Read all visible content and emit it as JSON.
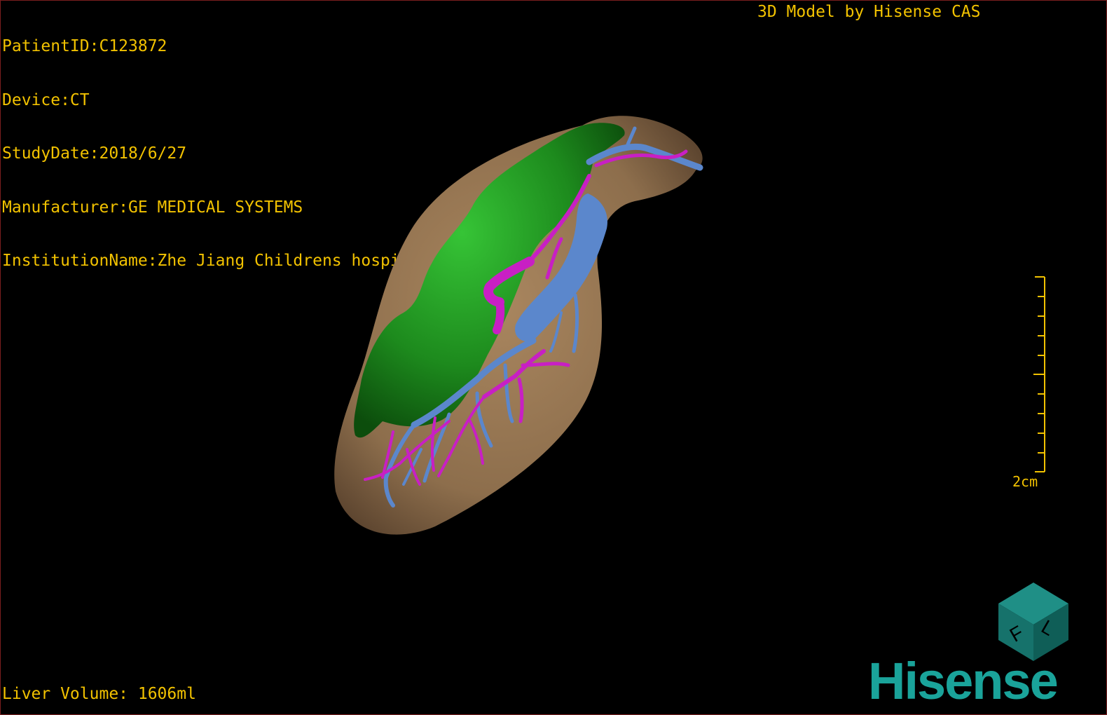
{
  "header": {
    "patient_id": "PatientID:C123872",
    "device": "Device:CT",
    "study_date": "StudyDate:2018/6/27",
    "manufacturer": "Manufacturer:GE MEDICAL SYSTEMS",
    "institution": "InstitutionName:Zhe Jiang Childrens hospital"
  },
  "model_label": "3D Model by Hisense CAS",
  "footer": {
    "liver_volume": "Liver Volume: 1606ml"
  },
  "scale_bar": {
    "label": "2cm"
  },
  "orientation_cube": {
    "face_letters": [
      "F",
      "L"
    ]
  },
  "brand": {
    "name": "Hisense"
  },
  "colors": {
    "text": "#f2c200",
    "liver": "#8d6e4c",
    "tumor": "#1d8a1d",
    "portal_vein": "#5b87cc",
    "hepatic_artery": "#c81fc4",
    "brand": "#1aa39a",
    "frame": "#7a1f1f"
  }
}
